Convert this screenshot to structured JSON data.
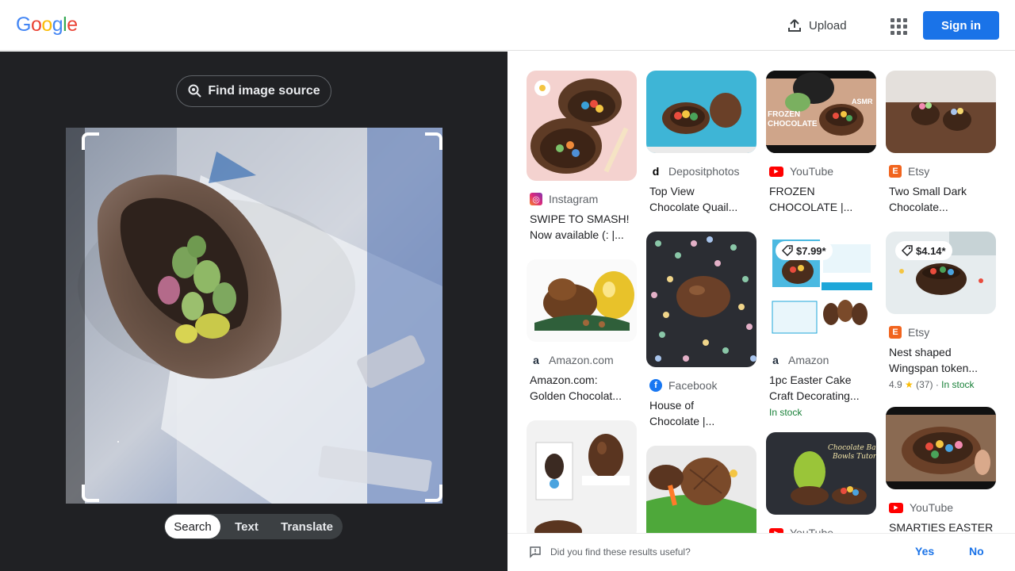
{
  "header": {
    "logo": [
      "G",
      "o",
      "o",
      "g",
      "l",
      "e"
    ],
    "logo_colors": [
      "#4285F4",
      "#EA4335",
      "#FBBC05",
      "#4285F4",
      "#34A853",
      "#EA4335"
    ],
    "upload_label": "Upload",
    "signin_label": "Sign in"
  },
  "lens": {
    "find_source_label": "Find image source",
    "modes": [
      "Search",
      "Text",
      "Translate"
    ],
    "active_mode": "Search"
  },
  "results": {
    "col1": [
      {
        "source": "Instagram",
        "source_icon": "instagram-icon",
        "title_1": "SWIPE TO SMASH!",
        "title_2": "Now available (: |..."
      },
      {
        "source": "Amazon.com",
        "source_icon": "amazon-icon",
        "title_1": "Amazon.com:",
        "title_2": "Golden Chocolat..."
      },
      {
        "source": "",
        "source_icon": "",
        "title_1": "",
        "title_2": ""
      }
    ],
    "col2": [
      {
        "source": "Depositphotos",
        "source_icon": "depositphotos-icon",
        "title_1": "Top View",
        "title_2": "Chocolate Quail..."
      },
      {
        "source": "Facebook",
        "source_icon": "facebook-icon",
        "title_1": "House of",
        "title_2": "Chocolate |..."
      },
      {
        "source": "",
        "source_icon": "",
        "title_1": "",
        "title_2": ""
      }
    ],
    "col3": [
      {
        "source": "YouTube",
        "source_icon": "youtube-icon",
        "title_1": "FROZEN",
        "title_2": "CHOCOLATE |..."
      },
      {
        "source": "Amazon",
        "source_icon": "amazon-icon",
        "title_1": "1pc Easter Cake",
        "title_2": "Craft Decorating...",
        "price": "$7.99*",
        "stock": "In stock"
      },
      {
        "source": "YouTube",
        "source_icon": "youtube-icon",
        "title_1": "",
        "title_2": ""
      }
    ],
    "col4": [
      {
        "source": "Etsy",
        "source_icon": "etsy-icon",
        "title_1": "Two Small Dark",
        "title_2": "Chocolate..."
      },
      {
        "source": "Etsy",
        "source_icon": "etsy-icon",
        "title_1": "Nest shaped",
        "title_2": "Wingspan token...",
        "price": "$4.14*",
        "rating": "4.9",
        "reviews": "(37)",
        "stock": "In stock"
      },
      {
        "source": "YouTube",
        "source_icon": "youtube-icon",
        "title_1": "SMARTIES EASTER",
        "title_2": ""
      }
    ]
  },
  "thumb_texts": {
    "frozen_line1": "FROZEN",
    "frozen_line2": "CHOCOLATE",
    "asmr": "ASMR",
    "balloon_1": "Chocolate Balloon",
    "balloon_2": "Bowls Tutorial"
  },
  "feedback": {
    "question": "Did you find these results useful?",
    "yes": "Yes",
    "no": "No"
  }
}
